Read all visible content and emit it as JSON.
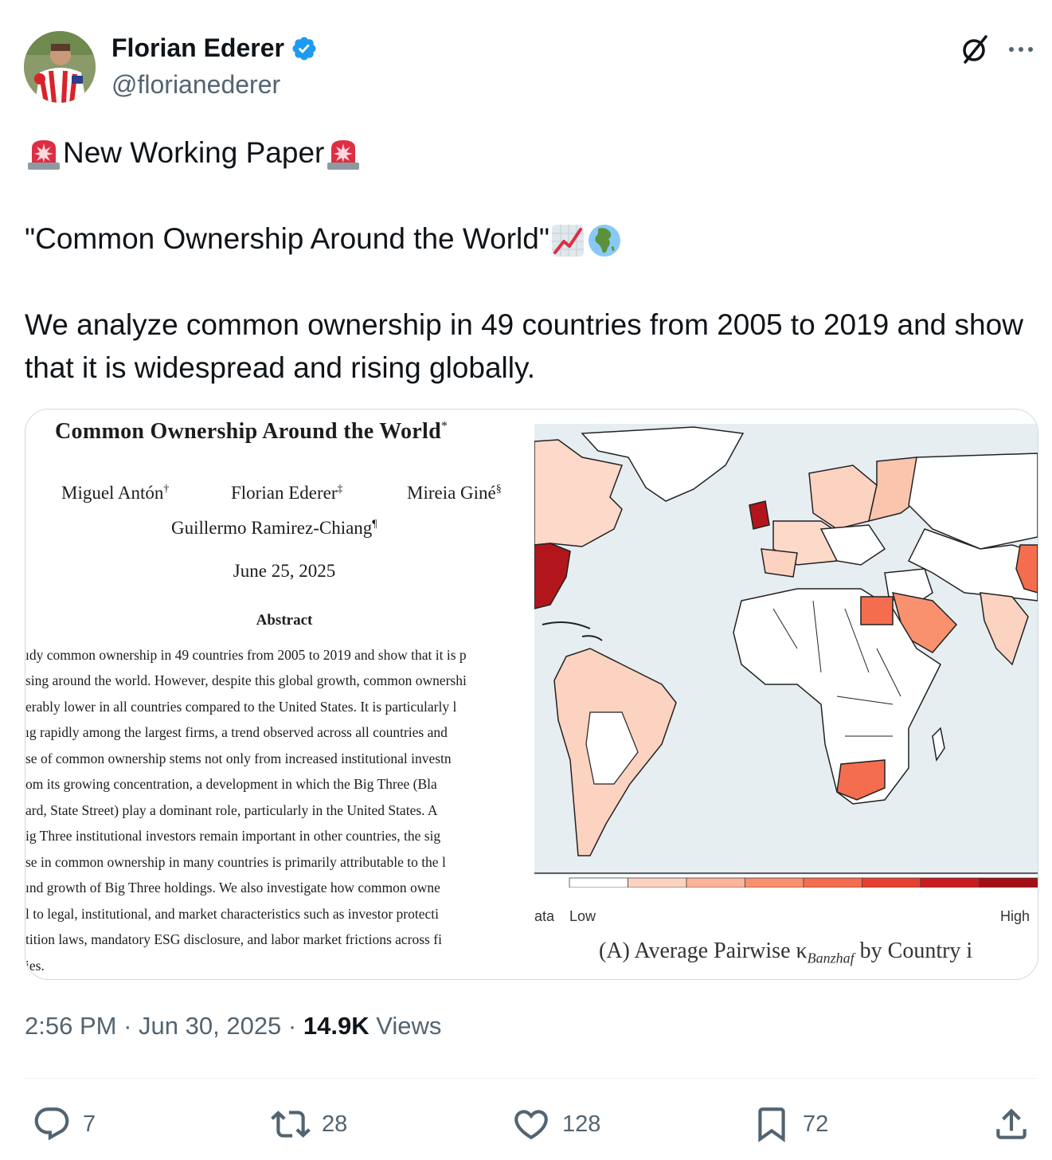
{
  "author": {
    "display_name": "Florian Ederer",
    "handle": "@florianederer",
    "verified": true
  },
  "icons": {
    "verified": "verified-badge-icon",
    "grok": "grok-icon",
    "more": "more-icon",
    "siren": "rotating-light-emoji",
    "chart": "chart-increasing-emoji",
    "globe": "globe-africa-emoji"
  },
  "tweet": {
    "line1": "New Working Paper",
    "line2": "\"Common Ownership Around the World\"",
    "line3": "We analyze common ownership in 49 countries from 2005 to 2019 and show that it is widespread and rising globally."
  },
  "paper": {
    "title": "Common Ownership Around the World",
    "title_mark": "*",
    "authors": [
      {
        "name": "Miguel Antón",
        "mark": "†"
      },
      {
        "name": "Florian Ederer",
        "mark": "‡"
      },
      {
        "name": "Mireia Giné",
        "mark": "§"
      },
      {
        "name": "Guillermo Ramirez-Chiang",
        "mark": "¶"
      }
    ],
    "date": "June 25, 2025",
    "abstract_heading": "Abstract",
    "abstract_lines": [
      "ıdy common ownership in 49 countries from 2005 to 2019 and show that it is p",
      "sing around the world. However, despite this global growth, common ownershi",
      "erably lower in all countries compared to the United States. It is particularly l",
      "ıg rapidly among the largest firms, a trend observed across all countries and",
      "se of common ownership stems not only from increased institutional investn",
      "om its growing concentration, a development in which the Big Three (Bla",
      "ard, State Street) play a dominant role, particularly in the United States. A",
      "ig Three institutional investors remain important in other countries, the sig",
      "se in common ownership in many countries is primarily attributable to the l",
      "ınd growth of Big Three holdings. We also investigate how common owne",
      "l to legal, institutional, and market characteristics such as investor protecti",
      "tition laws, mandatory ESG disclosure, and labor market frictions across fi",
      "ies."
    ]
  },
  "map": {
    "legend_edge": "ata",
    "legend_low": "Low",
    "legend_high": "High",
    "caption": "(A) Average Pairwise κ",
    "caption_sub": "Banzhaf",
    "caption_end": " by Country i",
    "scale_colors": [
      "#ffffff",
      "#fcd2c0",
      "#fbb49a",
      "#f9916f",
      "#f46d4e",
      "#e64030",
      "#c81d1f",
      "#a30f15"
    ]
  },
  "meta": {
    "time": "2:56 PM",
    "sep": "·",
    "date": "Jun 30, 2025",
    "views_count": "14.9K",
    "views_label": "Views"
  },
  "actions": {
    "replies": "7",
    "reposts": "28",
    "likes": "128",
    "bookmarks": "72"
  },
  "colors": {
    "text": "#0f1419",
    "secondary": "#536471",
    "verified": "#1d9bf0",
    "border": "#cfd9de"
  }
}
